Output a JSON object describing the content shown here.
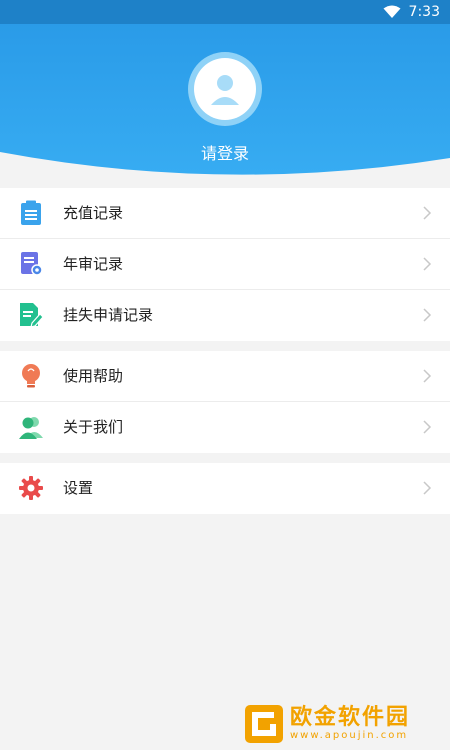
{
  "status_bar": {
    "time": "7:33",
    "icons": [
      "wifi-icon"
    ],
    "bg_color": "#1e81c8"
  },
  "header": {
    "login_text": "请登录",
    "bg_color": "#2fa4ee",
    "avatar_icon": "user-avatar-icon"
  },
  "menu": {
    "group1": [
      {
        "label": "充值记录",
        "icon": "clipboard-list-icon",
        "color": "#3aa3ec"
      },
      {
        "label": "年审记录",
        "icon": "document-settings-icon",
        "color": "#6b73e6"
      },
      {
        "label": "挂失申请记录",
        "icon": "document-edit-icon",
        "color": "#22c08f"
      }
    ],
    "group2": [
      {
        "label": "使用帮助",
        "icon": "lightbulb-icon",
        "color": "#f07a55"
      },
      {
        "label": "关于我们",
        "icon": "users-icon",
        "color": "#2fb57a"
      }
    ],
    "group3": [
      {
        "label": "设置",
        "icon": "gear-icon",
        "color": "#e94b4b"
      }
    ]
  },
  "watermark": {
    "title": "欧金软件园",
    "url": "www.apoujin.com",
    "color": "#f2a200"
  }
}
